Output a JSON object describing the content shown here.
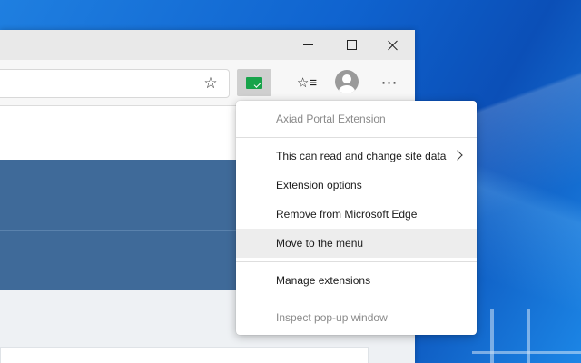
{
  "browser": {
    "window_controls": {
      "minimize": "minimize",
      "maximize": "maximize",
      "close": "close"
    },
    "toolbar": {
      "icons": [
        "star-icon",
        "extension-icon",
        "favorites-icon",
        "profile-icon",
        "more-icon"
      ],
      "more_label": "⋯"
    }
  },
  "context_menu": {
    "title": "Axiad Portal Extension",
    "items": [
      {
        "label": "This can read and change site data",
        "has_submenu": true
      },
      {
        "label": "Extension options"
      },
      {
        "label": "Remove from Microsoft Edge"
      },
      {
        "label": "Move to the menu",
        "highlighted": true
      },
      {
        "label": "Manage extensions"
      },
      {
        "label": "Inspect pop-up window",
        "disabled": true
      }
    ]
  },
  "colors": {
    "extension_icon": "#17a34a",
    "content_banner": "#3f6a99",
    "menu_highlight": "#ededed"
  }
}
